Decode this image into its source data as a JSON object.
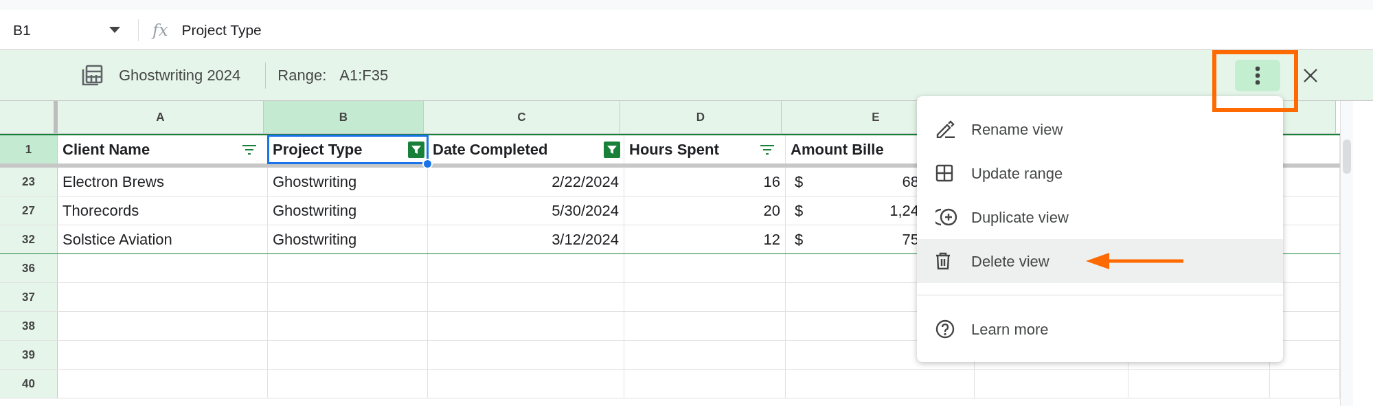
{
  "formula_bar": {
    "cell_ref": "B1",
    "fx": "fx",
    "value": "Project Type"
  },
  "filter_view": {
    "name": "Ghostwriting 2024",
    "range_label": "Range:",
    "range": "A1:F35"
  },
  "columns": [
    {
      "label": "A",
      "selected": false
    },
    {
      "label": "B",
      "selected": true
    },
    {
      "label": "C",
      "selected": false
    },
    {
      "label": "D",
      "selected": false
    },
    {
      "label": "E",
      "selected": false
    }
  ],
  "header_row": {
    "number": "1",
    "selected": true,
    "cells": [
      {
        "text": "Client Name",
        "filter_active": false,
        "selected": false
      },
      {
        "text": "Project Type",
        "filter_active": true,
        "selected": true
      },
      {
        "text": "Date Completed",
        "filter_active": true,
        "selected": false
      },
      {
        "text": "Hours Spent",
        "filter_active": false,
        "selected": false
      },
      {
        "text": "Amount Bille",
        "selected": false
      }
    ]
  },
  "rows": [
    {
      "number": "23",
      "cells": [
        "Electron Brews",
        "Ghostwriting",
        "2/22/2024",
        "16"
      ],
      "amount": {
        "currency": "$",
        "value": "68"
      }
    },
    {
      "number": "27",
      "cells": [
        "Thorecords",
        "Ghostwriting",
        "5/30/2024",
        "20"
      ],
      "amount": {
        "currency": "$",
        "value": "1,24"
      }
    },
    {
      "number": "32",
      "cells": [
        "Solstice Aviation",
        "Ghostwriting",
        "3/12/2024",
        "12"
      ],
      "amount": {
        "currency": "$",
        "value": "75"
      }
    }
  ],
  "empty_rows": [
    "36",
    "37",
    "38",
    "39",
    "40"
  ],
  "menu": {
    "items": [
      {
        "kind": "rename",
        "label": "Rename view",
        "selected": false
      },
      {
        "kind": "range",
        "label": "Update range",
        "selected": false
      },
      {
        "kind": "duplicate",
        "label": "Duplicate view",
        "selected": false
      },
      {
        "kind": "delete",
        "label": "Delete view",
        "selected": true
      },
      {
        "kind": "divider"
      },
      {
        "kind": "help",
        "label": "Learn more",
        "selected": false
      }
    ]
  },
  "annotations": {
    "highlight_box": true,
    "pointer_arrow": true
  }
}
